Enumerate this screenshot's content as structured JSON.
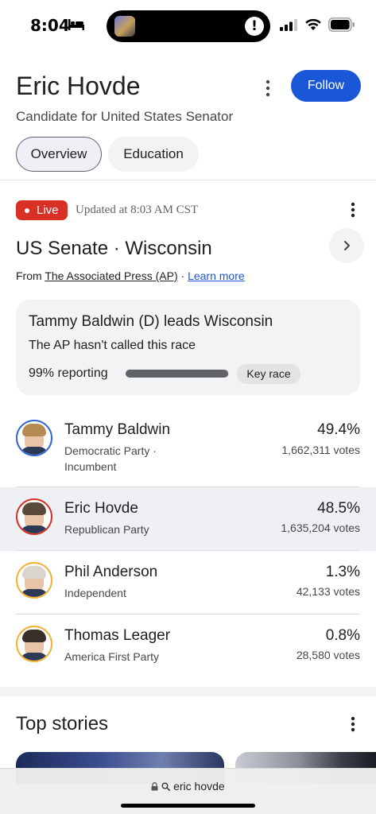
{
  "status_bar": {
    "time": "8:04",
    "icons": [
      "bed-icon",
      "signal-icon",
      "wifi-icon",
      "battery-icon"
    ],
    "island_alert": "!"
  },
  "header": {
    "title": "Eric Hovde",
    "subtitle": "Candidate for United States Senator",
    "follow_label": "Follow",
    "tabs": [
      {
        "label": "Overview",
        "selected": true
      },
      {
        "label": "Education",
        "selected": false
      }
    ]
  },
  "race": {
    "live_label": "Live",
    "updated": "Updated at 8:03 AM CST",
    "title": "US Senate · Wisconsin",
    "source_prefix": "From ",
    "source_name": "The Associated Press (AP)",
    "source_sep": " · ",
    "learn_more": "Learn more",
    "summary": {
      "headline": "Tammy Baldwin (D) leads Wisconsin",
      "status": "The AP hasn't called this race",
      "reporting": "99% reporting",
      "reporting_fraction": 0.99,
      "key_race": "Key race"
    },
    "candidates": [
      {
        "name": "Tammy Baldwin",
        "party": "Democratic Party ·",
        "note": "Incumbent",
        "pct": "49.4%",
        "votes": "1,662,311 votes",
        "ring": "#3367d6",
        "hair": "#b58a52",
        "highlight": false
      },
      {
        "name": "Eric Hovde",
        "party": "Republican Party",
        "note": "",
        "pct": "48.5%",
        "votes": "1,635,204 votes",
        "ring": "#d93025",
        "hair": "#5a4a3c",
        "highlight": true
      },
      {
        "name": "Phil Anderson",
        "party": "Independent",
        "note": "",
        "pct": "1.3%",
        "votes": "42,133 votes",
        "ring": "#f2b233",
        "hair": "#d9d4cc",
        "highlight": false
      },
      {
        "name": "Thomas Leager",
        "party": "America First Party",
        "note": "",
        "pct": "0.8%",
        "votes": "28,580 votes",
        "ring": "#f2b233",
        "hair": "#3a2f28",
        "highlight": false
      }
    ]
  },
  "top_stories": {
    "title": "Top stories"
  },
  "address_bar": {
    "query": "eric hovde"
  },
  "colors": {
    "accent": "#1a57d6",
    "live": "#d93025",
    "highlight_row": "#eef0f4"
  }
}
